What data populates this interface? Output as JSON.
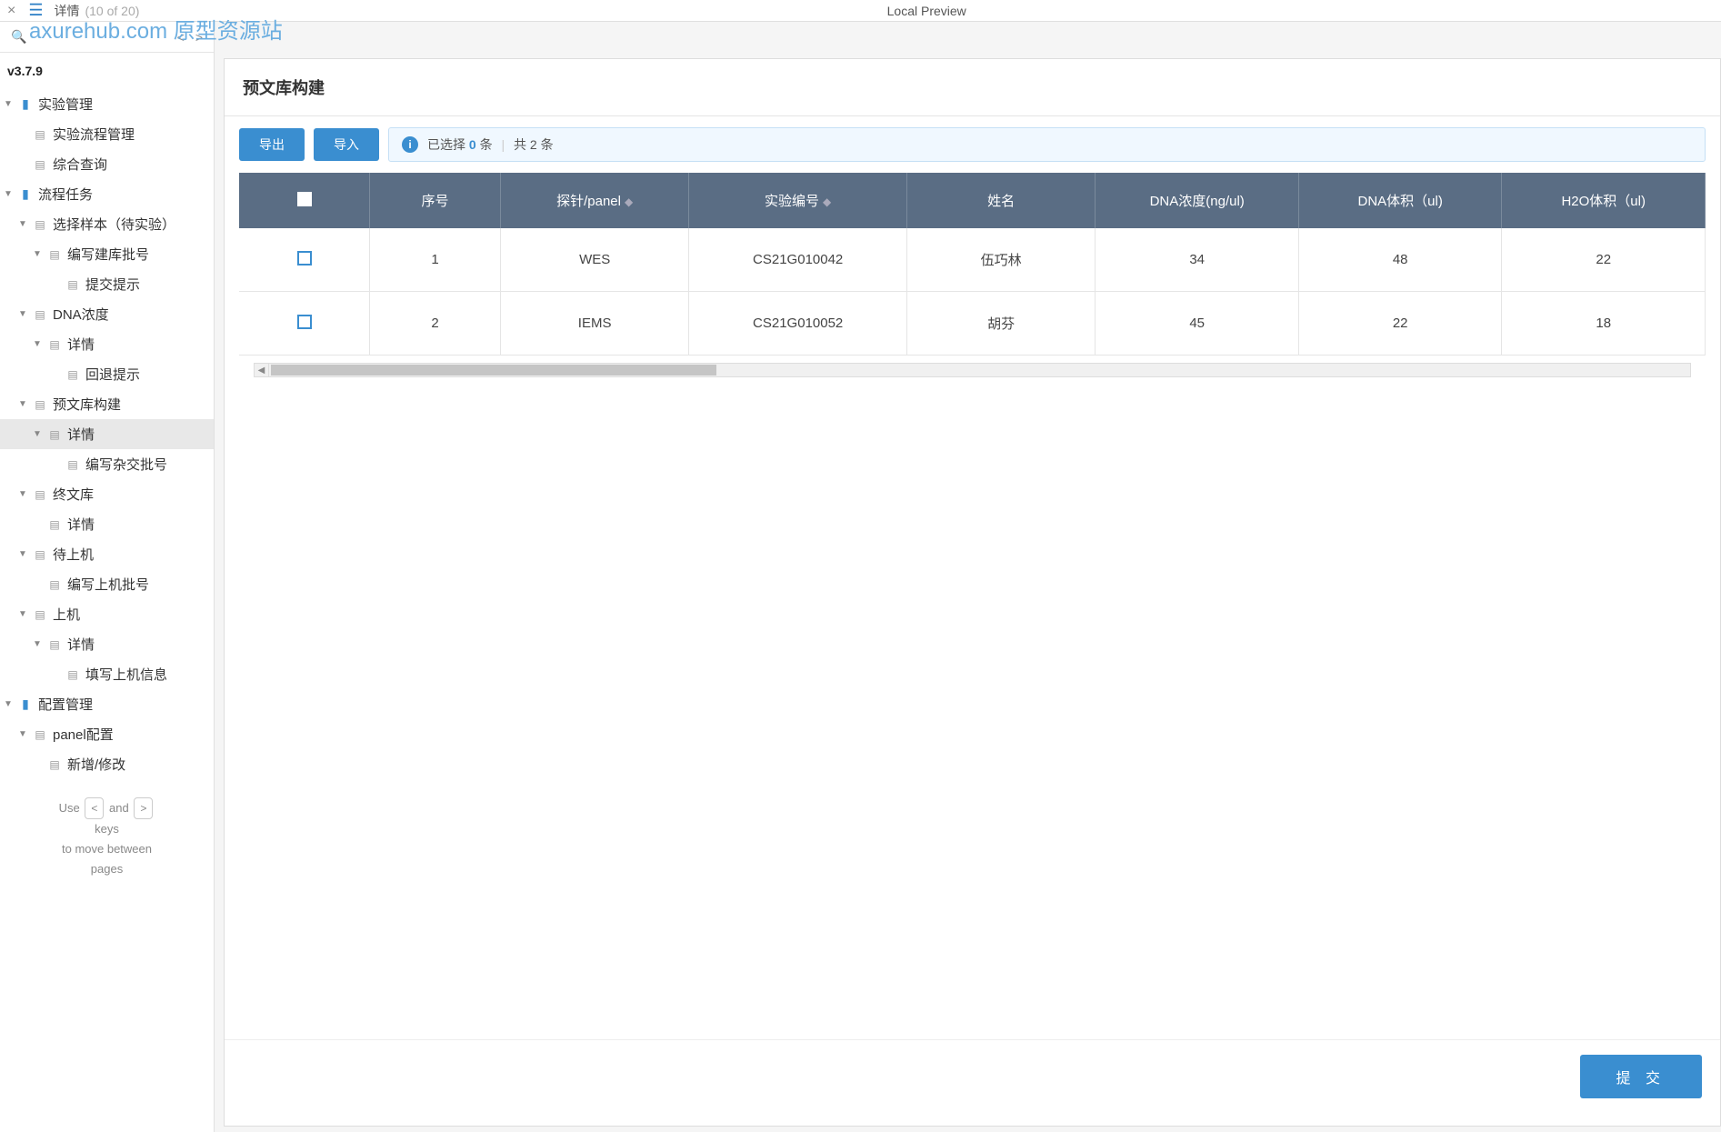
{
  "topbar": {
    "title": "详情",
    "count": "(10 of 20)",
    "center": "Local Preview"
  },
  "watermark": "axurehub.com 原型资源站",
  "sidebar": {
    "version": "v3.7.9",
    "tree": [
      {
        "label": "实验管理",
        "type": "folder",
        "indent": 0,
        "toggle": true
      },
      {
        "label": "实验流程管理",
        "type": "page",
        "indent": 1,
        "toggle": false
      },
      {
        "label": "综合查询",
        "type": "page",
        "indent": 1,
        "toggle": false
      },
      {
        "label": "流程任务",
        "type": "folder",
        "indent": 0,
        "toggle": true
      },
      {
        "label": "选择样本（待实验）",
        "type": "page",
        "indent": 1,
        "toggle": true
      },
      {
        "label": "编写建库批号",
        "type": "page",
        "indent": 2,
        "toggle": true
      },
      {
        "label": "提交提示",
        "type": "page",
        "indent": 3,
        "toggle": false
      },
      {
        "label": "DNA浓度",
        "type": "page",
        "indent": 1,
        "toggle": true
      },
      {
        "label": "详情",
        "type": "page",
        "indent": 2,
        "toggle": true
      },
      {
        "label": "回退提示",
        "type": "page",
        "indent": 3,
        "toggle": false
      },
      {
        "label": "预文库构建",
        "type": "page",
        "indent": 1,
        "toggle": true
      },
      {
        "label": "详情",
        "type": "page",
        "indent": 2,
        "toggle": true,
        "selected": true
      },
      {
        "label": "编写杂交批号",
        "type": "page",
        "indent": 3,
        "toggle": false
      },
      {
        "label": "终文库",
        "type": "page",
        "indent": 1,
        "toggle": true
      },
      {
        "label": "详情",
        "type": "page",
        "indent": 2,
        "toggle": false
      },
      {
        "label": "待上机",
        "type": "page",
        "indent": 1,
        "toggle": true
      },
      {
        "label": "编写上机批号",
        "type": "page",
        "indent": 2,
        "toggle": false
      },
      {
        "label": "上机",
        "type": "page",
        "indent": 1,
        "toggle": true
      },
      {
        "label": "详情",
        "type": "page",
        "indent": 2,
        "toggle": true
      },
      {
        "label": "填写上机信息",
        "type": "page",
        "indent": 3,
        "toggle": false
      },
      {
        "label": "配置管理",
        "type": "folder",
        "indent": 0,
        "toggle": true
      },
      {
        "label": "panel配置",
        "type": "page",
        "indent": 1,
        "toggle": true
      },
      {
        "label": "新增/修改",
        "type": "page",
        "indent": 2,
        "toggle": false
      }
    ],
    "hint": {
      "line1_a": "Use",
      "line1_b": "and",
      "line2": "keys",
      "line3": "to move between",
      "line4": "pages"
    }
  },
  "panel": {
    "title": "预文库构建",
    "export_btn": "导出",
    "import_btn": "导入",
    "selected_prefix": "已选择",
    "selected_count": "0",
    "selected_suffix": "条",
    "total": "共 2 条",
    "submit_btn": "提 交",
    "headers": [
      "序号",
      "探针/panel",
      "实验编号",
      "姓名",
      "DNA浓度(ng/ul)",
      "DNA体积（ul)",
      "H2O体积（ul)"
    ],
    "rows": [
      {
        "seq": "1",
        "panel": "WES",
        "exp_no": "CS21G010042",
        "name": "伍巧林",
        "dna_conc": "34",
        "dna_vol": "48",
        "h2o_vol": "22"
      },
      {
        "seq": "2",
        "panel": "IEMS",
        "exp_no": "CS21G010052",
        "name": "胡芬",
        "dna_conc": "45",
        "dna_vol": "22",
        "h2o_vol": "18"
      }
    ]
  }
}
